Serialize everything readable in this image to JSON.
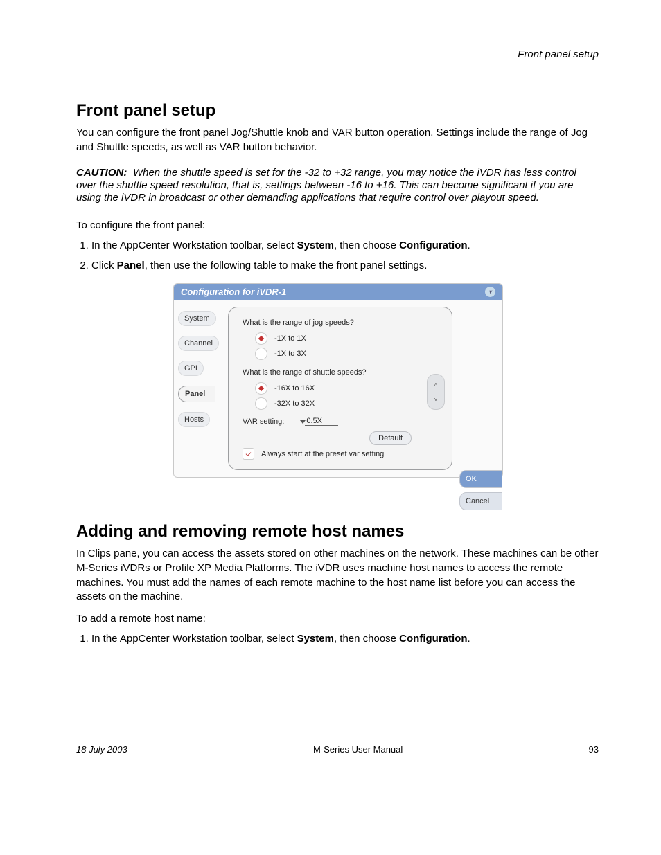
{
  "runningHead": "Front panel setup",
  "section1": {
    "title": "Front panel setup",
    "p1": "You can configure the front panel Jog/Shuttle knob and VAR button operation. Settings include the range of Jog and Shuttle speeds, as well as VAR button behavior.",
    "caution": {
      "label": "CAUTION:",
      "text": "When the shuttle speed is set for the -32 to +32 range, you may notice the iVDR has less control over the shuttle speed resolution, that is, settings between -16 to +16. This can become significant if you are using the iVDR in broadcast or other demanding applications that require control over playout speed."
    },
    "stepsIntro": "To configure the front panel:",
    "steps": [
      {
        "pre": "In the AppCenter Workstation toolbar, select ",
        "b1": "System",
        "mid": ", then choose ",
        "b2": "Configuration",
        "post": "."
      },
      {
        "pre": "Click ",
        "b1": "Panel",
        "post": ", then use the following table to make the front panel settings."
      }
    ]
  },
  "dialog": {
    "title": "Configuration for iVDR-1",
    "tabs": [
      "System",
      "Channel",
      "GPI",
      "Panel",
      "Hosts"
    ],
    "activeTab": 3,
    "q1": "What is the range of jog speeds?",
    "q1opts": [
      "-1X to 1X",
      "-1X to 3X"
    ],
    "q1sel": 0,
    "q2": "What is the range of shuttle speeds?",
    "q2opts": [
      "-16X to 16X",
      "-32X to 32X"
    ],
    "q2sel": 0,
    "varLabel": "VAR setting:",
    "varValue": "0.5X",
    "defaultLabel": "Default",
    "checkLabel": "Always start at the preset var setting",
    "ok": "OK",
    "cancel": "Cancel"
  },
  "section2": {
    "title": "Adding and removing remote host names",
    "p1": "In Clips pane, you can access the assets stored on other machines on the network. These machines can be other M-Series iVDRs or Profile XP Media Platforms. The iVDR uses machine host names to access the remote machines. You must add the names of each remote machine to the host name list before you can access the assets on the machine.",
    "stepsIntro": "To add a remote host name:",
    "steps": [
      {
        "pre": "In the AppCenter Workstation toolbar, select ",
        "b1": "System",
        "mid": ", then choose ",
        "b2": "Configuration",
        "post": "."
      }
    ]
  },
  "footer": {
    "date": "18 July 2003",
    "center": "M-Series User Manual",
    "page": "93"
  }
}
